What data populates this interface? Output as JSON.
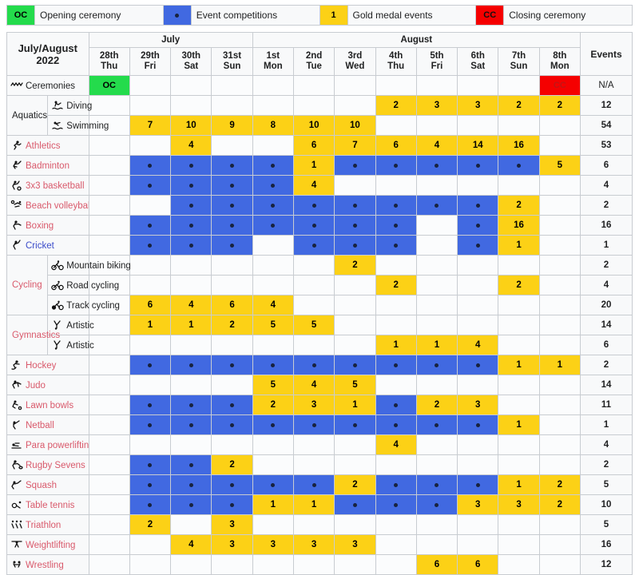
{
  "legend": {
    "items": [
      {
        "key": "OC",
        "label": "Opening ceremony",
        "type": "oc"
      },
      {
        "key": "",
        "label": "Event competitions",
        "type": "ev"
      },
      {
        "key": "1",
        "label": "Gold medal events",
        "type": "gm"
      },
      {
        "key": "CC",
        "label": "Closing ceremony",
        "type": "cc"
      }
    ]
  },
  "colors": {
    "opening": "#24db4c",
    "closing": "#f50000",
    "competition": "#4169e1",
    "gold": "#fcd116",
    "sport_text": "#d9596b",
    "sport_text_alt": "#3b4cca"
  },
  "header": {
    "title": "July/August 2022",
    "events_label": "Events",
    "months": [
      {
        "name": "July",
        "span": 4
      },
      {
        "name": "August",
        "span": 8
      }
    ],
    "days": [
      {
        "date": "28th",
        "dow": "Thu"
      },
      {
        "date": "29th",
        "dow": "Fri"
      },
      {
        "date": "30th",
        "dow": "Sat"
      },
      {
        "date": "31st",
        "dow": "Sun"
      },
      {
        "date": "1st",
        "dow": "Mon"
      },
      {
        "date": "2nd",
        "dow": "Tue"
      },
      {
        "date": "3rd",
        "dow": "Wed"
      },
      {
        "date": "4th",
        "dow": "Thu"
      },
      {
        "date": "5th",
        "dow": "Fri"
      },
      {
        "date": "6th",
        "dow": "Sat"
      },
      {
        "date": "7th",
        "dow": "Sun"
      },
      {
        "date": "8th",
        "dow": "Mon"
      }
    ]
  },
  "rows": [
    {
      "name": "Ceremonies",
      "icon": "ceremonies-icon",
      "style": "plain",
      "cells": [
        "",
        "OC",
        "",
        "",
        "",
        "",
        "",
        "",
        "",
        "",
        "",
        "",
        ""
      ],
      "events": "N/A"
    },
    {
      "group": "Aquatics",
      "group_rows": 2,
      "name": "Diving",
      "icon": "diving-icon",
      "sub": true,
      "cells": [
        "",
        "",
        "",
        "",
        "",
        "",
        "",
        "2",
        "3",
        "3",
        "2",
        "2"
      ],
      "events": "12"
    },
    {
      "name": "Swimming",
      "icon": "swimming-icon",
      "sub": true,
      "cells": [
        "",
        "7",
        "10",
        "9",
        "8",
        "10",
        "10",
        "",
        "",
        "",
        "",
        ""
      ],
      "events": "54"
    },
    {
      "name": "Athletics",
      "icon": "athletics-icon",
      "cells": [
        "",
        "",
        "4",
        "",
        "",
        "6",
        "7",
        "6",
        "4",
        "14",
        "16",
        ""
      ],
      "events": "53"
    },
    {
      "name": "Badminton",
      "icon": "badminton-icon",
      "cells": [
        "",
        ".",
        ".",
        ".",
        ".",
        "1",
        ".",
        ".",
        ".",
        ".",
        ".",
        "5"
      ],
      "events": "6"
    },
    {
      "name": "3x3 basketball",
      "icon": "basketball-icon",
      "cells": [
        "",
        ".",
        ".",
        ".",
        ".",
        "4",
        "",
        "",
        "",
        "",
        "",
        ""
      ],
      "events": "4"
    },
    {
      "name": "Beach volleyball",
      "icon": "volleyball-icon",
      "cells": [
        "",
        "",
        ".",
        ".",
        ".",
        ".",
        ".",
        ".",
        ".",
        ".",
        "2",
        ""
      ],
      "events": "2"
    },
    {
      "name": "Boxing",
      "icon": "boxing-icon",
      "cells": [
        "",
        ".",
        ".",
        ".",
        ".",
        ".",
        ".",
        ".",
        "",
        ".",
        "16",
        ""
      ],
      "events": "16"
    },
    {
      "name": "Cricket",
      "icon": "cricket-icon",
      "style": "alt",
      "cells": [
        "",
        ".",
        ".",
        ".",
        "",
        ".",
        ".",
        ".",
        "",
        ".",
        "1",
        ""
      ],
      "events": "1"
    },
    {
      "group": "Cycling",
      "group_rows": 3,
      "name": "Mountain biking",
      "icon": "mountain-biking-icon",
      "sub": true,
      "cells": [
        "",
        "",
        "",
        "",
        "",
        "",
        "2",
        "",
        "",
        "",
        "",
        ""
      ],
      "events": "2"
    },
    {
      "name": "Road cycling",
      "icon": "road-cycling-icon",
      "sub": true,
      "cells": [
        "",
        "",
        "",
        "",
        "",
        "",
        "",
        "2",
        "",
        "",
        "2",
        ""
      ],
      "events": "4"
    },
    {
      "name": "Track cycling",
      "icon": "track-cycling-icon",
      "sub": true,
      "cells": [
        "",
        "6",
        "4",
        "6",
        "4",
        "",
        "",
        "",
        "",
        "",
        "",
        ""
      ],
      "events": "20"
    },
    {
      "group": "Gymnastics",
      "group_rows": 2,
      "name": "Artistic",
      "icon": "gymnastics-icon",
      "sub": true,
      "cells": [
        "",
        "1",
        "1",
        "2",
        "5",
        "5",
        "",
        "",
        "",
        "",
        "",
        ""
      ],
      "events": "14"
    },
    {
      "name": "Artistic",
      "icon": "gymnastics-icon",
      "sub": true,
      "cells": [
        "",
        "",
        "",
        "",
        "",
        "",
        "",
        "1",
        "1",
        "4",
        "",
        ""
      ],
      "events": "6"
    },
    {
      "name": "Hockey",
      "icon": "hockey-icon",
      "cells": [
        "",
        ".",
        ".",
        ".",
        ".",
        ".",
        ".",
        ".",
        ".",
        ".",
        "1",
        "1"
      ],
      "events": "2"
    },
    {
      "name": "Judo",
      "icon": "judo-icon",
      "cells": [
        "",
        "",
        "",
        "",
        "5",
        "4",
        "5",
        "",
        "",
        "",
        "",
        ""
      ],
      "events": "14"
    },
    {
      "name": "Lawn bowls",
      "icon": "lawn-bowls-icon",
      "cells": [
        "",
        ".",
        ".",
        ".",
        "2",
        "3",
        "1",
        ".",
        "2",
        "3",
        "",
        ""
      ],
      "events": "11"
    },
    {
      "name": "Netball",
      "icon": "netball-icon",
      "cells": [
        "",
        ".",
        ".",
        ".",
        ".",
        ".",
        ".",
        ".",
        ".",
        ".",
        "1",
        ""
      ],
      "events": "1"
    },
    {
      "name": "Para powerlifting",
      "icon": "para-powerlifting-icon",
      "cells": [
        "",
        "",
        "",
        "",
        "",
        "",
        "",
        "4",
        "",
        "",
        "",
        ""
      ],
      "events": "4"
    },
    {
      "name": "Rugby Sevens",
      "icon": "rugby-icon",
      "cells": [
        "",
        ".",
        ".",
        "2",
        "",
        "",
        "",
        "",
        "",
        "",
        "",
        ""
      ],
      "events": "2"
    },
    {
      "name": "Squash",
      "icon": "squash-icon",
      "cells": [
        "",
        ".",
        ".",
        ".",
        ".",
        ".",
        "2",
        ".",
        ".",
        ".",
        "1",
        "2"
      ],
      "events": "5"
    },
    {
      "name": "Table tennis",
      "icon": "table-tennis-icon",
      "cells": [
        "",
        ".",
        ".",
        ".",
        "1",
        "1",
        ".",
        ".",
        ".",
        "3",
        "3",
        "2"
      ],
      "events": "10"
    },
    {
      "name": "Triathlon",
      "icon": "triathlon-icon",
      "cells": [
        "",
        "2",
        "",
        "3",
        "",
        "",
        "",
        "",
        "",
        "",
        "",
        ""
      ],
      "events": "5"
    },
    {
      "name": "Weightlifting",
      "icon": "weightlifting-icon",
      "cells": [
        "",
        "",
        "4",
        "3",
        "3",
        "3",
        "3",
        "",
        "",
        "",
        "",
        ""
      ],
      "events": "16"
    },
    {
      "name": "Wrestling",
      "icon": "wrestling-icon",
      "cells": [
        "",
        "",
        "",
        "",
        "",
        "",
        "",
        "",
        "6",
        "6",
        "",
        ""
      ],
      "events": "12"
    }
  ],
  "ceremony_cells": {
    "oc_col": 0,
    "cc_col": 11,
    "oc": "OC",
    "cc": "CC"
  }
}
